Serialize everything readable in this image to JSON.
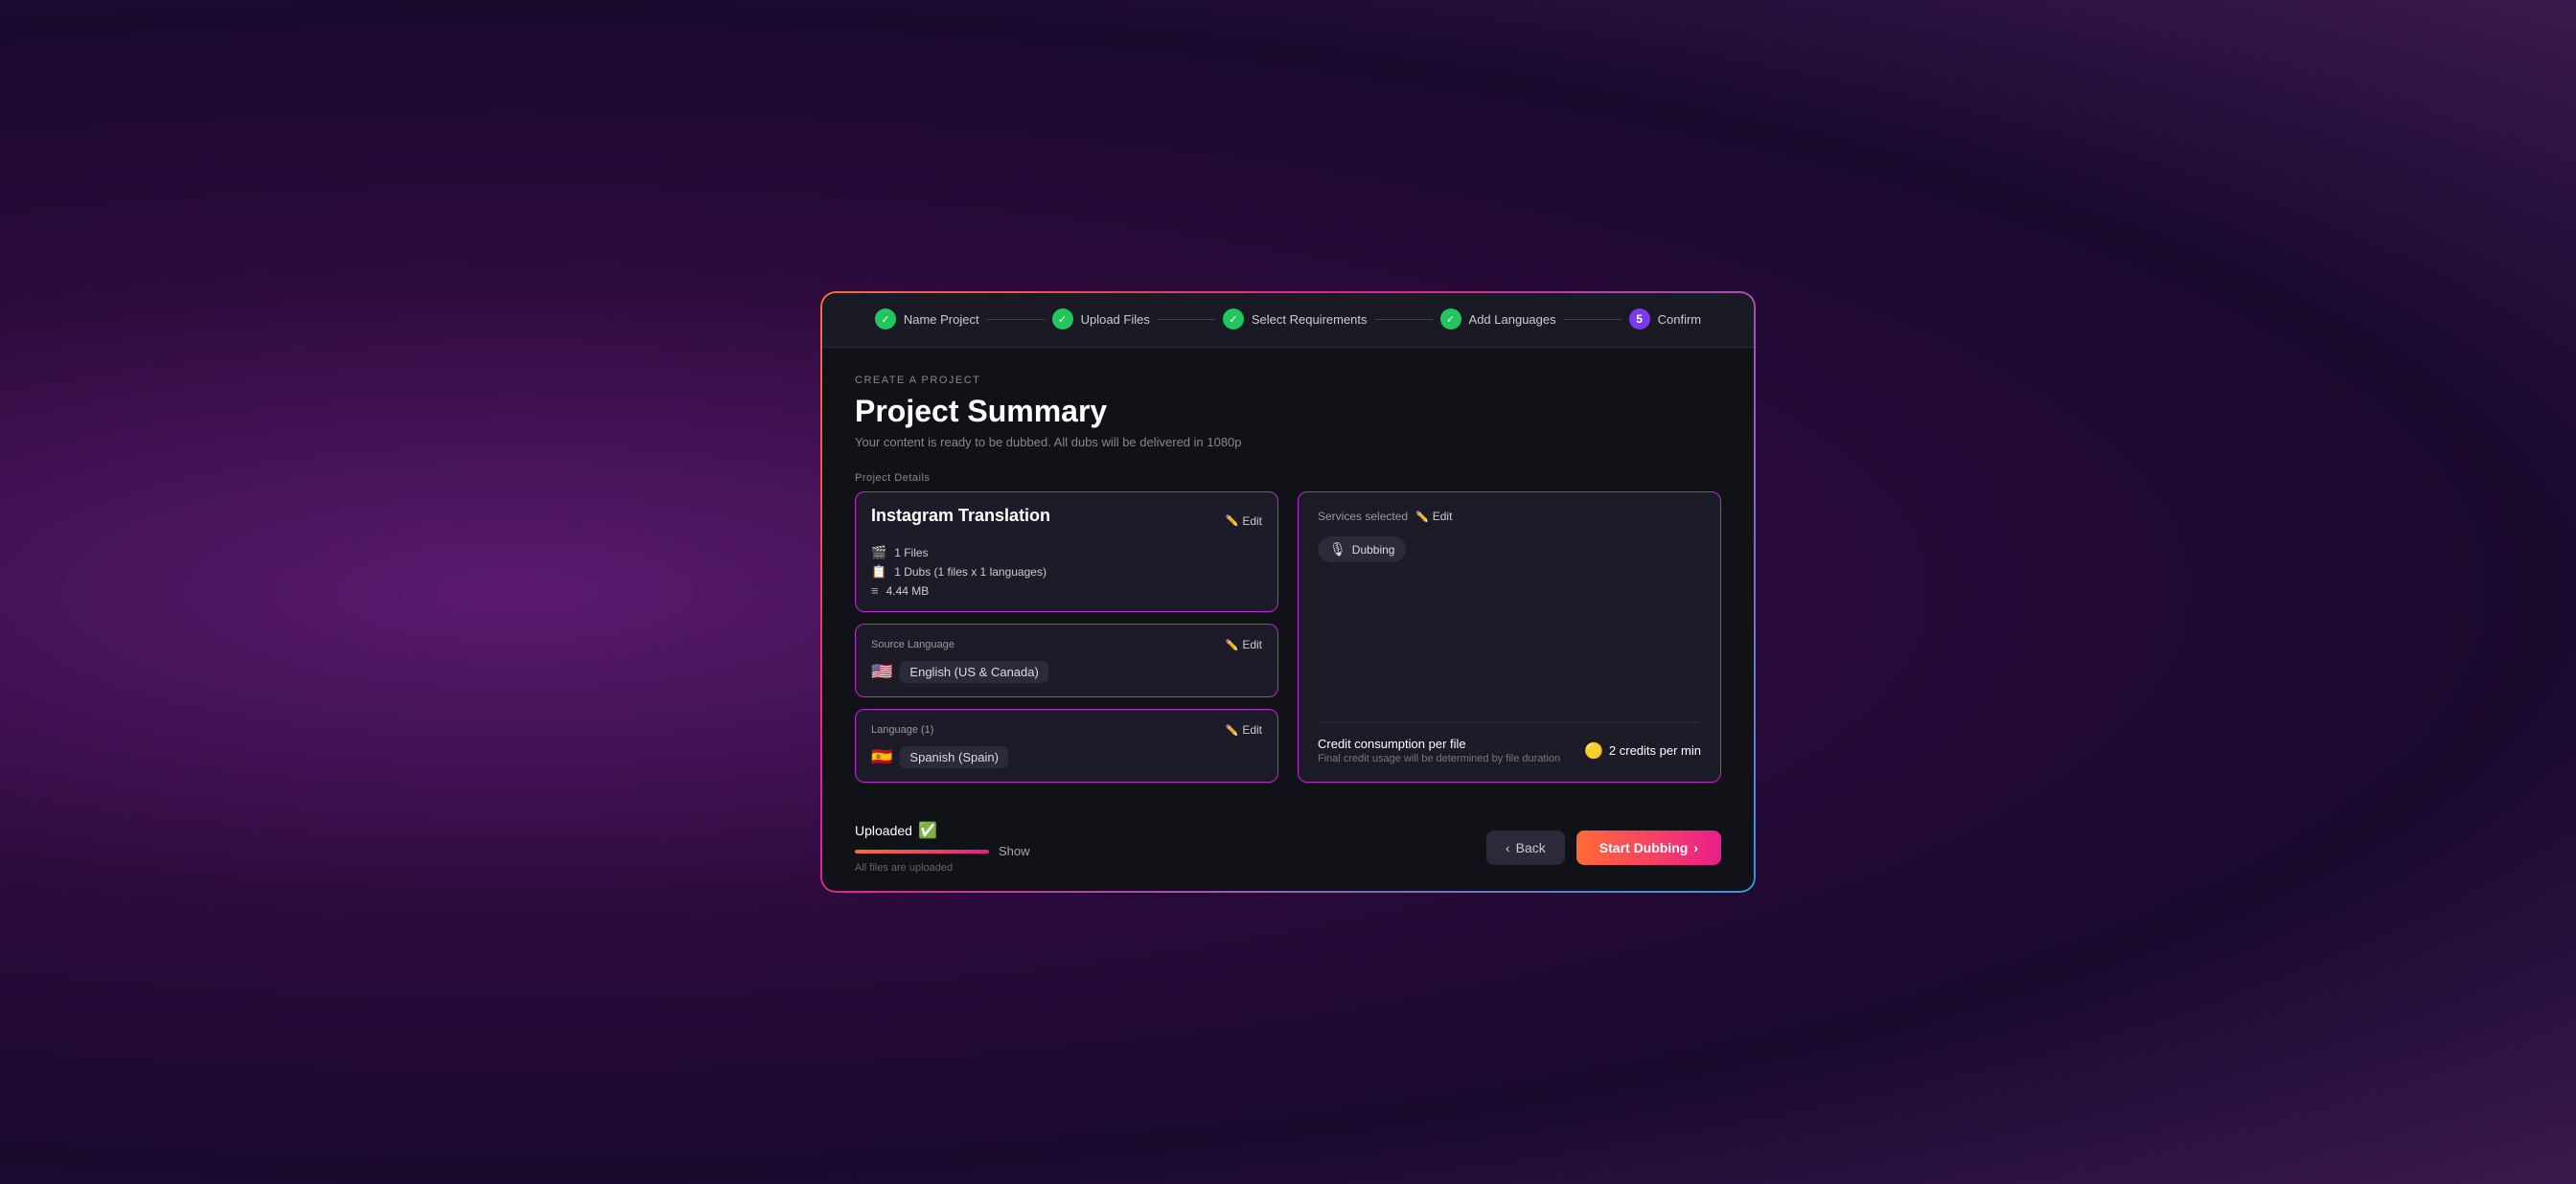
{
  "stepper": {
    "steps": [
      {
        "id": "name-project",
        "label": "Name Project",
        "status": "done",
        "icon": "✓",
        "number": null
      },
      {
        "id": "upload-files",
        "label": "Upload Files",
        "status": "done",
        "icon": "✓",
        "number": null
      },
      {
        "id": "select-requirements",
        "label": "Select Requirements",
        "status": "done",
        "icon": "✓",
        "number": null
      },
      {
        "id": "add-languages",
        "label": "Add Languages",
        "status": "done",
        "icon": "✓",
        "number": null
      },
      {
        "id": "confirm",
        "label": "Confirm",
        "status": "active",
        "icon": null,
        "number": "5"
      }
    ]
  },
  "page": {
    "create_label": "CREATE A PROJECT",
    "title": "Project Summary",
    "subtitle": "Your content is ready to be dubbed. All dubs will be delivered in 1080p"
  },
  "project_details": {
    "section_label": "Project Details",
    "card": {
      "name": "Instagram Translation",
      "edit_label": "Edit",
      "files_count": "1 Files",
      "dubs_info": "1 Dubs  (1 files x 1 languages)",
      "file_size": "4.44 MB"
    }
  },
  "source_language": {
    "card_title": "Source Language",
    "edit_label": "Edit",
    "language": "English (US & Canada)",
    "flag": "🇺🇸"
  },
  "target_language": {
    "card_title": "Language (1)",
    "edit_label": "Edit",
    "language": "Spanish (Spain)",
    "flag": "🇪🇸"
  },
  "services": {
    "card_title": "Services selected",
    "edit_label": "Edit",
    "dubbing_label": "Dubbing",
    "credit_label": "Credit consumption per file",
    "credit_sublabel": "Final credit usage will be determined by file duration",
    "credit_value": "2 credits per min"
  },
  "footer": {
    "upload_status": "Uploaded",
    "all_uploaded": "All files are uploaded",
    "show_label": "Show",
    "back_label": "Back",
    "start_label": "Start Dubbing"
  }
}
